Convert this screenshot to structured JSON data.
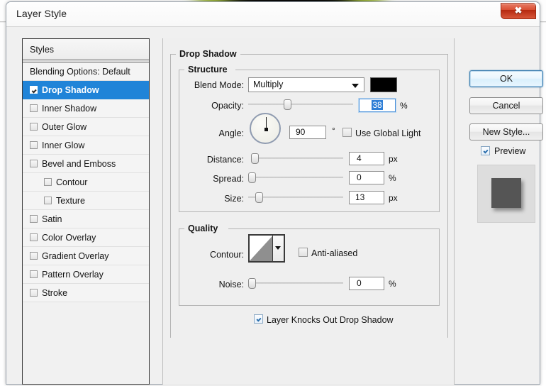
{
  "window": {
    "title": "Layer Style",
    "close_label": "✖"
  },
  "styles_panel": {
    "header": "Styles",
    "items": [
      {
        "label": "Blending Options: Default",
        "checkbox": "none",
        "checked": false,
        "selected": false,
        "indent": false
      },
      {
        "label": "Drop Shadow",
        "checkbox": "checkbox",
        "checked": true,
        "selected": true,
        "indent": false
      },
      {
        "label": "Inner Shadow",
        "checkbox": "checkbox",
        "checked": false,
        "selected": false,
        "indent": false
      },
      {
        "label": "Outer Glow",
        "checkbox": "checkbox",
        "checked": false,
        "selected": false,
        "indent": false
      },
      {
        "label": "Inner Glow",
        "checkbox": "checkbox",
        "checked": false,
        "selected": false,
        "indent": false
      },
      {
        "label": "Bevel and Emboss",
        "checkbox": "checkbox",
        "checked": false,
        "selected": false,
        "indent": false
      },
      {
        "label": "Contour",
        "checkbox": "checkbox",
        "checked": false,
        "selected": false,
        "indent": true
      },
      {
        "label": "Texture",
        "checkbox": "checkbox",
        "checked": false,
        "selected": false,
        "indent": true
      },
      {
        "label": "Satin",
        "checkbox": "checkbox",
        "checked": false,
        "selected": false,
        "indent": false
      },
      {
        "label": "Color Overlay",
        "checkbox": "checkbox",
        "checked": false,
        "selected": false,
        "indent": false
      },
      {
        "label": "Gradient Overlay",
        "checkbox": "checkbox",
        "checked": false,
        "selected": false,
        "indent": false
      },
      {
        "label": "Pattern Overlay",
        "checkbox": "checkbox",
        "checked": false,
        "selected": false,
        "indent": false
      },
      {
        "label": "Stroke",
        "checkbox": "checkbox",
        "checked": false,
        "selected": false,
        "indent": false
      }
    ]
  },
  "main": {
    "section_title": "Drop Shadow",
    "structure": {
      "title": "Structure",
      "blend_mode_label": "Blend Mode:",
      "blend_mode_value": "Multiply",
      "shadow_color": "#000000",
      "opacity_label": "Opacity:",
      "opacity_value": "38",
      "opacity_unit": "%",
      "angle_label": "Angle:",
      "angle_value": "90",
      "angle_unit": "°",
      "use_global_light_label": "Use Global Light",
      "use_global_light_checked": false,
      "distance_label": "Distance:",
      "distance_value": "4",
      "distance_unit": "px",
      "spread_label": "Spread:",
      "spread_value": "0",
      "spread_unit": "%",
      "size_label": "Size:",
      "size_value": "13",
      "size_unit": "px"
    },
    "quality": {
      "title": "Quality",
      "contour_label": "Contour:",
      "anti_aliased_label": "Anti-aliased",
      "anti_aliased_checked": false,
      "noise_label": "Noise:",
      "noise_value": "0",
      "noise_unit": "%"
    },
    "knockout_label": "Layer Knocks Out Drop Shadow",
    "knockout_checked": true
  },
  "buttons": {
    "ok": "OK",
    "cancel": "Cancel",
    "new_style": "New Style...",
    "preview_label": "Preview",
    "preview_checked": true
  },
  "colors": {
    "selection_blue": "#2084d8",
    "accent_blue": "#3c7fb1",
    "dialog_bg": "#efefef",
    "backdrop_green": "#9cb43c",
    "preview_shape": "#555555"
  }
}
